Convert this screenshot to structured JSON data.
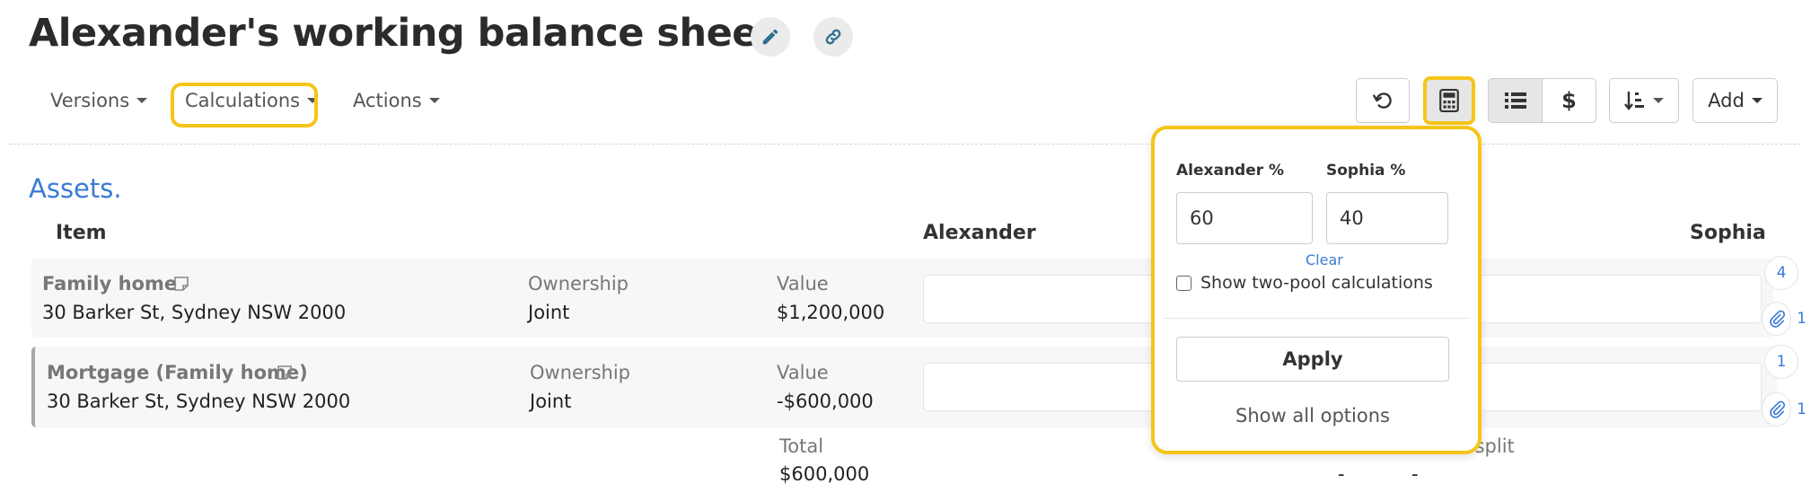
{
  "page": {
    "title": "Alexander's working balance sheet"
  },
  "menu": {
    "versions": "Versions",
    "calculations": "Calculations",
    "actions": "Actions"
  },
  "toolbar": {
    "dollar": "$",
    "add": "Add"
  },
  "section": {
    "assets": "Assets."
  },
  "columns": {
    "item": "Item",
    "alexander": "Alexander",
    "sophia": "Sophia"
  },
  "rows": [
    {
      "name": "Family home",
      "address": "30 Barker St, Sydney NSW 2000",
      "ownership_label": "Ownership",
      "ownership": "Joint",
      "value_label": "Value",
      "value": "$1,200,000"
    },
    {
      "name": "Mortgage (Family home)",
      "address": "30 Barker St, Sydney NSW 2000",
      "ownership_label": "Ownership",
      "ownership": "Joint",
      "value_label": "Value",
      "value": "-$600,000"
    }
  ],
  "totals": {
    "label": "Total",
    "value": "$600,000",
    "split_label": "s split",
    "dash1": "-",
    "dash2": "-"
  },
  "popover": {
    "alexander_label": "Alexander %",
    "alexander_value": "60",
    "sophia_label": "Sophia %",
    "sophia_value": "40",
    "clear": "Clear",
    "two_pool": "Show two-pool calculations",
    "apply": "Apply",
    "show_all": "Show all options"
  },
  "side": {
    "badge1": "4",
    "attach1": "1",
    "badge2": "1",
    "attach2": "1"
  },
  "colors": {
    "accent": "#3a7bd5",
    "highlight": "#f5c518"
  }
}
